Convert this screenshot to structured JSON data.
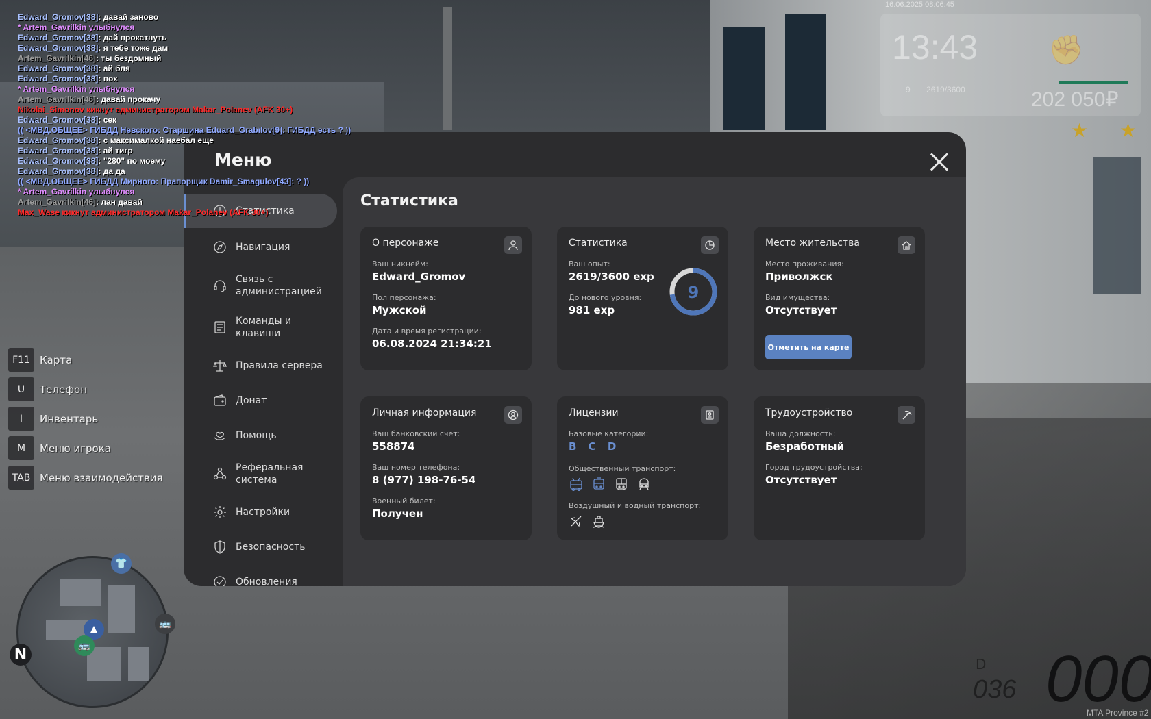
{
  "chat": [
    {
      "name": "Edward_Gromov[38]",
      "name_color": "#a9c1ff",
      "text": ": давай заново",
      "text_color": "#ffffff"
    },
    {
      "name": "* Artem_Gavrilkin улыбнулся",
      "name_color": "#e08cff",
      "text": "",
      "text_color": "#e08cff"
    },
    {
      "name": "Edward_Gromov[38]",
      "name_color": "#a9c1ff",
      "text": ": дай прокатнуть",
      "text_color": "#ffffff"
    },
    {
      "name": "Edward_Gromov[38]",
      "name_color": "#a9c1ff",
      "text": ": я тебе тоже дам",
      "text_color": "#ffffff"
    },
    {
      "name": "Artem_Gavrilkin[46]",
      "name_color": "#9a9a9a",
      "text": ": ты бездомный",
      "text_color": "#ffffff"
    },
    {
      "name": "Edward_Gromov[38]",
      "name_color": "#a9c1ff",
      "text": ": ай бля",
      "text_color": "#ffffff"
    },
    {
      "name": "Edward_Gromov[38]",
      "name_color": "#a9c1ff",
      "text": ": пох",
      "text_color": "#ffffff"
    },
    {
      "name": "* Artem_Gavrilkin улыбнулся",
      "name_color": "#e08cff",
      "text": "",
      "text_color": "#e08cff"
    },
    {
      "name": "Artem_Gavrilkin[46]",
      "name_color": "#9a9a9a",
      "text": ": давай прокачу",
      "text_color": "#ffffff"
    },
    {
      "name": "Nikolai_Simonov кикнут администратором Makar_Polanev (AFK 30+)",
      "name_color": "#ff2a2a",
      "text": "",
      "text_color": "#ff2a2a"
    },
    {
      "name": "Edward_Gromov[38]",
      "name_color": "#a9c1ff",
      "text": ": сек",
      "text_color": "#ffffff"
    },
    {
      "name": "(( <МВД.ОБЩЕЕ> ГИБДД Невского: Старшина Eduard_Grabilov[9]: ГИБДД есть ? ))",
      "name_color": "#8fa8ff",
      "text": "",
      "text_color": "#8fa8ff"
    },
    {
      "name": "Edward_Gromov[38]",
      "name_color": "#a9c1ff",
      "text": ": с максималкой наебал еще",
      "text_color": "#ffffff"
    },
    {
      "name": "Edward_Gromov[38]",
      "name_color": "#a9c1ff",
      "text": ": ай тигр",
      "text_color": "#ffffff"
    },
    {
      "name": "Edward_Gromov[38]",
      "name_color": "#a9c1ff",
      "text": ": \"280\" по моему",
      "text_color": "#ffffff"
    },
    {
      "name": "Edward_Gromov[38]",
      "name_color": "#a9c1ff",
      "text": ": да да",
      "text_color": "#ffffff"
    },
    {
      "name": "(( <МВД.ОБЩЕЕ> ГИБДД Мирного: Прапорщик Damir_Smagulov[43]: ? ))",
      "name_color": "#8fa8ff",
      "text": "",
      "text_color": "#8fa8ff"
    },
    {
      "name": "* Artem_Gavrilkin улыбнулся",
      "name_color": "#e08cff",
      "text": "",
      "text_color": "#e08cff"
    },
    {
      "name": "Artem_Gavrilkin[46]",
      "name_color": "#9a9a9a",
      "text": ": лан давай",
      "text_color": "#ffffff"
    },
    {
      "name": "Max_Wase кикнут администратором Makar_Polanev (AFK 30+)",
      "name_color": "#ff2a2a",
      "text": "",
      "text_color": "#ff2a2a"
    }
  ],
  "hud": {
    "date": "16.06.2025 08:06:45",
    "time": "13:43",
    "level": "9",
    "xp": "2619/3600",
    "money": "202 050₽"
  },
  "hints": [
    {
      "key": "F11",
      "label": "Карта"
    },
    {
      "key": "U",
      "label": "Телефон"
    },
    {
      "key": "I",
      "label": "Инвентарь"
    },
    {
      "key": "M",
      "label": "Меню игрока"
    },
    {
      "key": "TAB",
      "label": "Меню взаимодействия"
    }
  ],
  "minimap": {
    "north": "N"
  },
  "vehicle": {
    "speed": "000",
    "fuel": "036",
    "gear": "D"
  },
  "server_name": "MTA Province #2",
  "menu": {
    "title": "Меню",
    "nav": [
      {
        "label": "Статистика",
        "icon": "clock-icon",
        "active": true
      },
      {
        "label": "Навигация",
        "icon": "compass-icon"
      },
      {
        "label": "Связь с администрацией",
        "icon": "headset-icon"
      },
      {
        "label": "Команды и клавиши",
        "icon": "list-icon"
      },
      {
        "label": "Правила сервера",
        "icon": "scales-icon"
      },
      {
        "label": "Донат",
        "icon": "wallet-icon"
      },
      {
        "label": "Помощь",
        "icon": "hand-heart-icon"
      },
      {
        "label": "Реферальная система",
        "icon": "network-icon"
      },
      {
        "label": "Настройки",
        "icon": "gear-icon"
      },
      {
        "label": "Безопасность",
        "icon": "shield-icon"
      },
      {
        "label": "Обновления",
        "icon": "refresh-icon"
      }
    ]
  },
  "stats_page": {
    "title": "Статистика",
    "character": {
      "title": "О персонаже",
      "nickname_label": "Ваш никнейм:",
      "nickname": "Edward_Gromov",
      "gender_label": "Пол персонажа:",
      "gender": "Мужской",
      "reg_label": "Дата и время регистрации:",
      "reg": "06.08.2024 21:34:21"
    },
    "statistics": {
      "title": "Статистика",
      "xp_label": "Ваш опыт:",
      "xp": "2619/3600 exp",
      "next_label": "До нового уровня:",
      "next": "981 exp",
      "level": "9",
      "progress": 0.7275
    },
    "residence": {
      "title": "Место жительства",
      "city_label": "Место проживания:",
      "city": "Приволжск",
      "property_label": "Вид имущества:",
      "property": "Отсутствует",
      "button": "Отметить на карте"
    },
    "personal": {
      "title": "Личная информация",
      "bank_label": "Ваш банковский счет:",
      "bank": "558874",
      "phone_label": "Ваш номер телефона:",
      "phone": "8 (977) 198-76-54",
      "military_label": "Военный билет:",
      "military": "Получен"
    },
    "licenses": {
      "title": "Лицензии",
      "base_label": "Базовые категории:",
      "base": "B C D",
      "public_label": "Общественный транспорт:",
      "air_label": "Воздушный и водный транспорт:"
    },
    "employment": {
      "title": "Трудоустройство",
      "position_label": "Ваша должность:",
      "position": "Безработный",
      "city_label": "Город трудоустройства:",
      "city": "Отсутствует"
    }
  },
  "colors": {
    "accent": "#6a8fd1",
    "panel": "#2c2c2e",
    "card_area": "#38383b",
    "button": "#5b82c1"
  }
}
